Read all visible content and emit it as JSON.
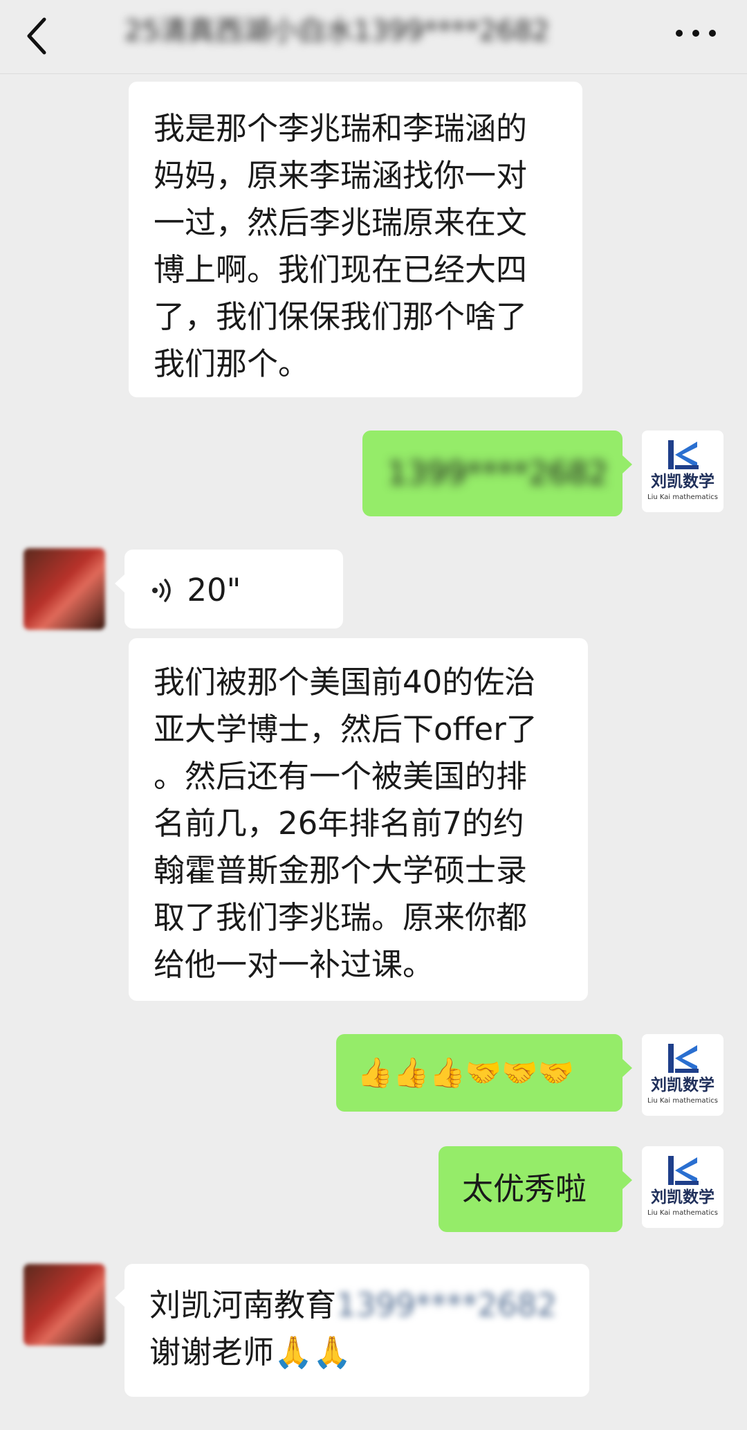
{
  "header": {
    "back_label": "<",
    "title": "25清真西湖小白水1399****2682",
    "more_label": "···"
  },
  "brand": {
    "cn": "刘凯数学",
    "en": "Liu Kai mathematics"
  },
  "messages": [
    {
      "id": "m1",
      "side": "in",
      "text_lines": [
        "我是那个李兆瑞和李瑞涵的",
        "妈妈，原来李瑞涵找你一对",
        "一过，然后李兆瑞原来在文",
        "博上啊。我们现在已经大四",
        "了，我们保保我们那个啥了",
        "我们那个。"
      ]
    },
    {
      "id": "m2",
      "side": "out",
      "text": "1399****2682"
    },
    {
      "id": "m3",
      "side": "in",
      "type": "voice",
      "duration": "20\""
    },
    {
      "id": "m4",
      "side": "in",
      "text_lines": [
        "我们被那个美国前40的佐治",
        "亚大学博士，然后下offer了",
        "。然后还有一个被美国的排",
        "名前几，26年排名前7的约",
        "翰霍普斯金那个大学硕士录",
        "取了我们李兆瑞。原来你都",
        "给他一对一补过课。"
      ]
    },
    {
      "id": "m5",
      "side": "out",
      "text": "👍👍👍🤝🤝🤝"
    },
    {
      "id": "m6",
      "side": "out",
      "text": "太优秀啦"
    },
    {
      "id": "m7",
      "side": "in",
      "name_text": "刘凯河南教育",
      "phone_text": "1399****2682",
      "line2": "谢谢老师🙏🙏"
    }
  ]
}
